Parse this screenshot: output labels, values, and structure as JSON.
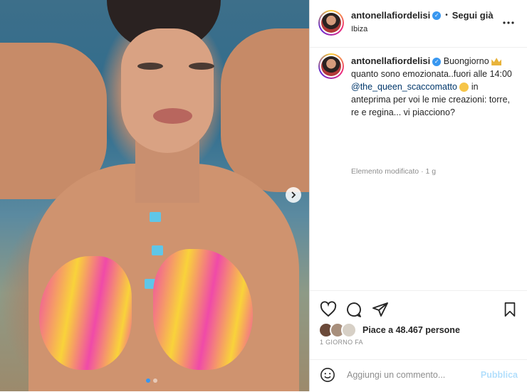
{
  "post": {
    "username": "antonellafiordelisi",
    "follow_label": "Segui già",
    "separator": "•",
    "location": "Ibiza",
    "more_icon": "more-horizontal-icon"
  },
  "caption": {
    "username": "antonellafiordelisi",
    "text_start": "Buongiorno",
    "text_line2": "quanto sono emozionata..fuori alle 14:00",
    "mention": "@the_queen_scaccomatto",
    "text_end": "in anteprima per voi le mie creazioni: torre, re e regina... vi piacciono?",
    "edited_label": "Elemento modificato",
    "edited_sep": "·",
    "edited_age": "1 g"
  },
  "engagement": {
    "likes_label": "Piace a 48.467 persone",
    "time_label": "1 GIORNO FA"
  },
  "comment": {
    "placeholder": "Aggiungi un commento...",
    "publish_label": "Pubblica"
  },
  "colors": {
    "accent": "#3897f0",
    "publish_disabled": "#b2dffc",
    "text": "#262626",
    "muted": "#8e8e8e",
    "mention": "#00376b"
  }
}
